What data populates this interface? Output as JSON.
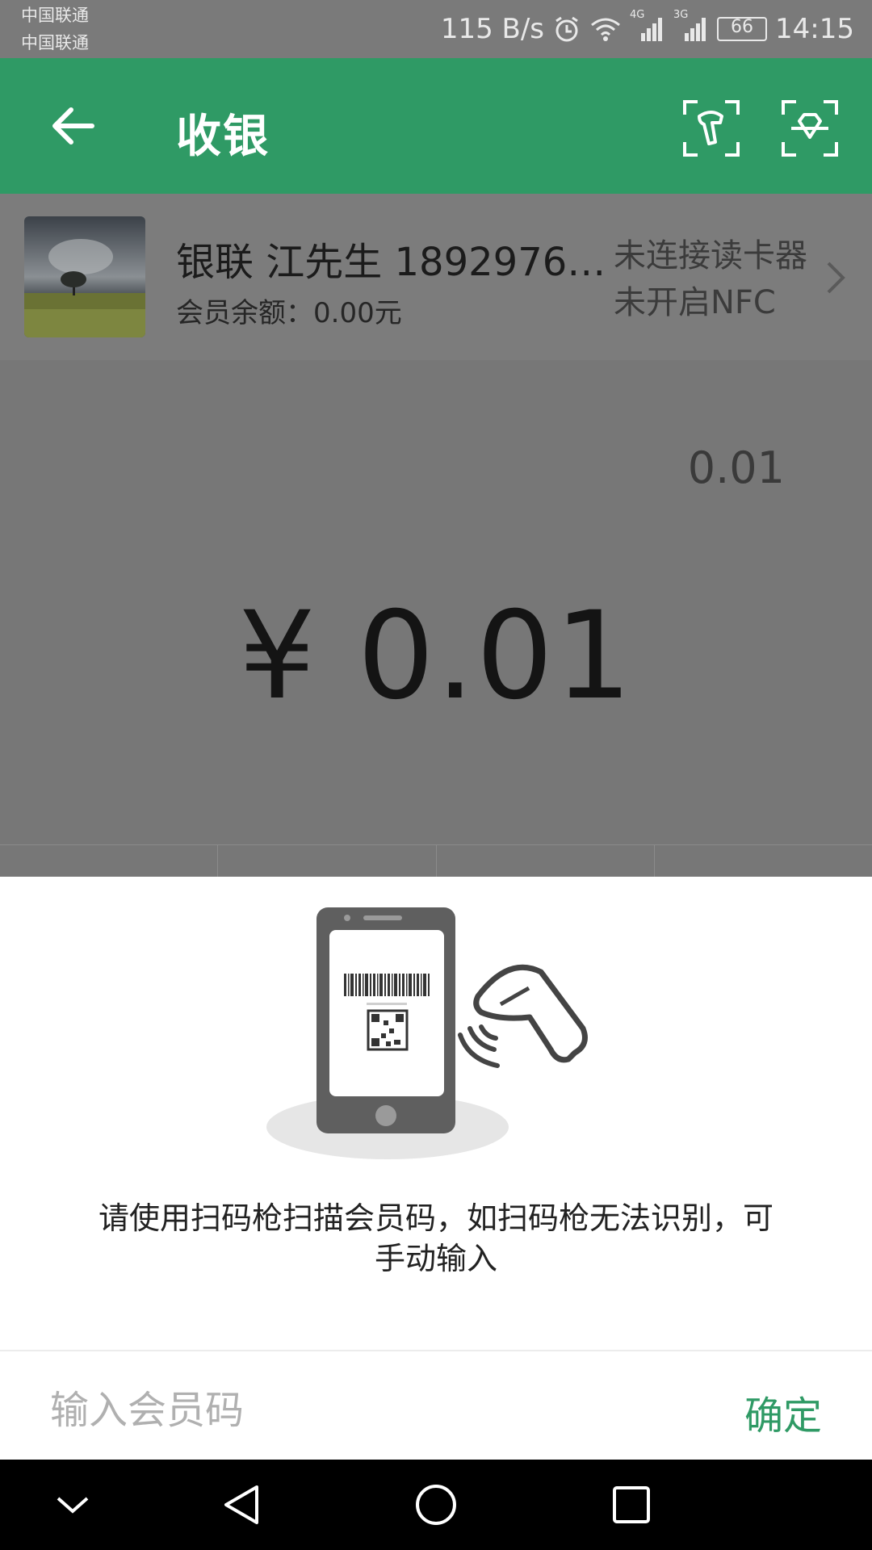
{
  "status_bar": {
    "carrier_1": "中国联通",
    "carrier_2": "中国联通",
    "speed": "115 B/s",
    "network_1": "4G",
    "network_2": "3G",
    "battery": "66",
    "time": "14:15"
  },
  "toolbar": {
    "title": "收银",
    "bg_color": "#2f9a65"
  },
  "member": {
    "name": "银联 江先生 18929766...",
    "balance": "会员余额：0.00元",
    "reader_status": "未连接读卡器",
    "nfc_status": "未开启NFC"
  },
  "amount": {
    "small": "0.01",
    "total": "¥ 0.01"
  },
  "scan_sheet": {
    "hint": "请使用扫码枪扫描会员码，如扫码枪无法识别，可手动输入",
    "input_placeholder": "输入会员码",
    "confirm_label": "确定",
    "accent_color": "#2f9a65"
  },
  "icons": {
    "back": "back-arrow-icon",
    "scanner": "barcode-scanner-icon",
    "scan_frame": "scan-diamond-icon",
    "chevron": "chevron-right-icon",
    "nav_back": "nav-back-icon",
    "nav_home": "nav-home-icon",
    "nav_recent": "nav-recent-icon",
    "nav_hide": "nav-hide-icon"
  }
}
